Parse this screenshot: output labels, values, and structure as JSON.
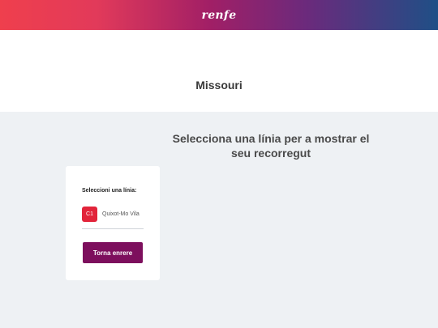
{
  "header": {
    "logo_text": "renfe",
    "gradient_colors": [
      "#ef3f4d",
      "#a11f66",
      "#1f4f86"
    ]
  },
  "station": {
    "title": "Missouri"
  },
  "main": {
    "prompt": "Selecciona una línia per a mostrar el seu recorregut"
  },
  "panel": {
    "label": "Seleccioni una línia:",
    "lines": [
      {
        "code": "C1",
        "name": "Quixot-Mo Vila",
        "color": "#e2243a"
      }
    ],
    "back_button_label": "Torna enrere",
    "back_button_color": "#7d0f5d"
  }
}
